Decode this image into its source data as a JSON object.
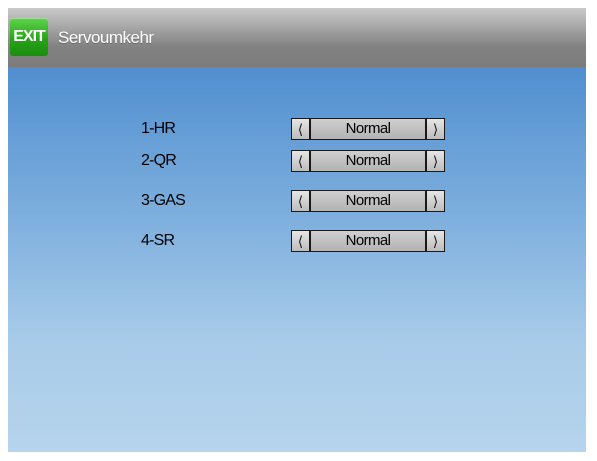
{
  "header": {
    "exit_label": "EXIT",
    "title": "Servoumkehr"
  },
  "channels": [
    {
      "label": "1-HR",
      "value": "Normal"
    },
    {
      "label": "2-QR",
      "value": "Normal"
    },
    {
      "label": "3-GAS",
      "value": "Normal"
    },
    {
      "label": "4-SR",
      "value": "Normal"
    }
  ],
  "icons": {
    "left": "chevron-left-icon",
    "right": "chevron-right-icon"
  },
  "colors": {
    "exit_button": "#27a518",
    "background_top": "#3d81cc",
    "background_bottom": "#b6d4ec",
    "titlebar": "#9a9a9a"
  }
}
